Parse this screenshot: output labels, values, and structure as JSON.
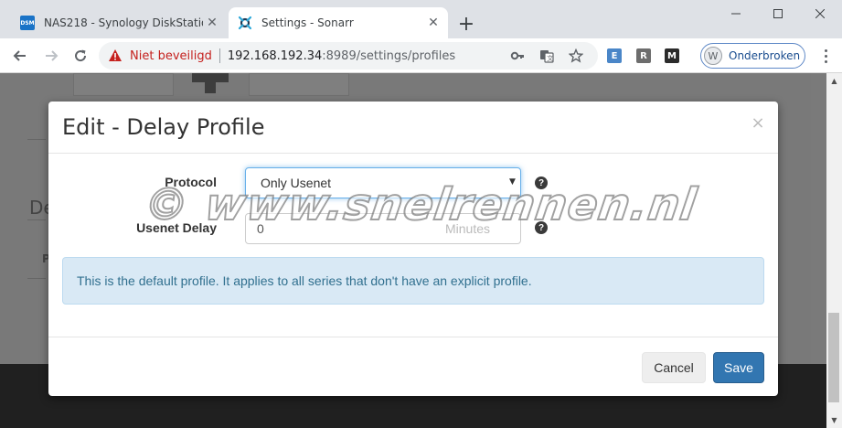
{
  "browser": {
    "tabs": [
      {
        "favicon": "DSM",
        "title": "NAS218 - Synology DiskStation",
        "active": false
      },
      {
        "favicon": "sonarr-icon",
        "title": "Settings - Sonarr",
        "active": true
      }
    ],
    "new_tab_icon": "+",
    "window_controls": {
      "minimize": "minimize-icon",
      "maximize": "maximize-icon",
      "close": "close-icon"
    },
    "nav": {
      "back": "back-arrow-icon",
      "forward": "forward-arrow-icon",
      "reload": "reload-icon"
    },
    "omnibox": {
      "security_label": "Niet beveiligd",
      "url_host": "192.168.192.34",
      "url_path": ":8989/settings/profiles"
    },
    "extensions": [
      "E",
      "R",
      "M"
    ],
    "profile": {
      "initial": "W",
      "label": "Onderbroken"
    }
  },
  "background": {
    "heading": "De",
    "column_header": "P"
  },
  "modal": {
    "title": "Edit - Delay Profile",
    "close_symbol": "×",
    "fields": {
      "protocol": {
        "label": "Protocol",
        "value": "Only Usenet"
      },
      "usenet_delay": {
        "label": "Usenet Delay",
        "value": "0",
        "unit": "Minutes"
      }
    },
    "help_symbol": "?",
    "info": "This is the default profile. It applies to all series that don't have an explicit profile.",
    "buttons": {
      "cancel": "Cancel",
      "save": "Save"
    }
  },
  "watermark": "© www.snelrennen.nl",
  "colors": {
    "primary_button": "#3276b1",
    "info_background": "#d9e9f5",
    "info_text": "#31708f",
    "warning_text": "#c5221f",
    "select_focus": "#66afe9"
  }
}
